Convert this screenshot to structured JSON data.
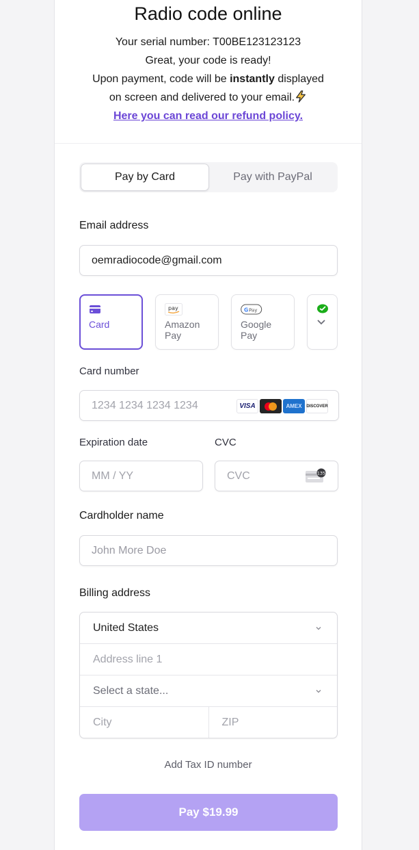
{
  "header": {
    "title": "Radio code online",
    "serial_label": "Your serial number: ",
    "serial_value": "T00BE123123123",
    "ready_text": "Great, your code is ready!",
    "payment_text_before": "Upon payment, code will be ",
    "payment_text_bold": "instantly",
    "payment_text_after": " displayed",
    "payment_text_line2": "on screen and delivered to your email.",
    "refund_link": "Here you can read our refund policy."
  },
  "tabs": [
    {
      "label": "Pay by Card",
      "active": true
    },
    {
      "label": "Pay with PayPal",
      "active": false
    }
  ],
  "email": {
    "label": "Email address",
    "value": "oemradiocode@gmail.com"
  },
  "payment_methods": [
    {
      "label": "Card",
      "icon": "credit-card-icon",
      "active": true
    },
    {
      "label": "Amazon Pay",
      "icon": "amazon-pay-icon",
      "active": false
    },
    {
      "label": "Google Pay",
      "icon": "google-pay-icon",
      "active": false
    },
    {
      "label": "",
      "icon": "wechat-pay-icon",
      "active": false
    }
  ],
  "card": {
    "number_label": "Card number",
    "number_placeholder": "1234 1234 1234 1234",
    "brands": [
      "VISA",
      "Mastercard",
      "AMEX",
      "DISCOVER"
    ],
    "expiry_label": "Expiration date",
    "expiry_placeholder": "MM / YY",
    "cvc_label": "CVC",
    "cvc_placeholder": "CVC",
    "cvc_hint": "135"
  },
  "cardholder": {
    "label": "Cardholder name",
    "placeholder": "John More Doe"
  },
  "billing": {
    "label": "Billing address",
    "country": "United States",
    "address_placeholder": "Address line 1",
    "state_placeholder": "Select a state...",
    "city_placeholder": "City",
    "zip_placeholder": "ZIP"
  },
  "tax_id_link": "Add Tax ID number",
  "pay_button": "Pay $19.99",
  "colors": {
    "accent": "#6b4fd8",
    "pay_button": "#b4a2f3",
    "link": "#6b46d6"
  }
}
